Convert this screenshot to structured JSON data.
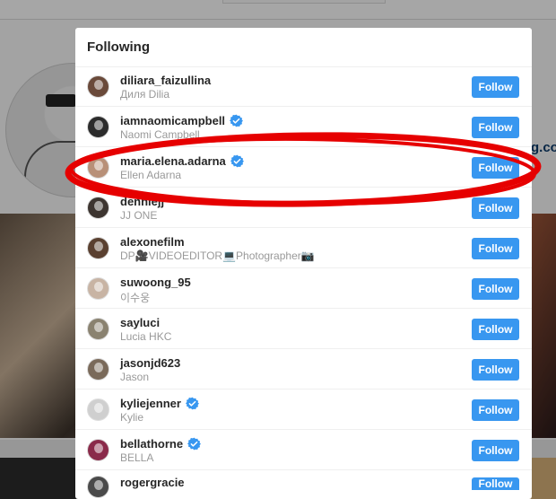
{
  "background": {
    "link_fragment": "g.co"
  },
  "modal": {
    "title": "Following",
    "follow_label": "Follow",
    "accent_color": "#3897f0",
    "highlight_color": "#e60000",
    "highlighted_user": "maria.elena.adarna",
    "users": [
      {
        "username": "diliara_faizullina",
        "full_name": "Диля Dilia",
        "verified": false,
        "avatar_color": "#6a4a3a"
      },
      {
        "username": "iamnaomicampbell",
        "full_name": "Naomi Campbell",
        "verified": true,
        "avatar_color": "#2c2c2c"
      },
      {
        "username": "maria.elena.adarna",
        "full_name": "Ellen Adarna",
        "verified": true,
        "avatar_color": "#b89078"
      },
      {
        "username": "denniejj",
        "full_name": "JJ ONE",
        "verified": false,
        "avatar_color": "#3d3530"
      },
      {
        "username": "alexonefilm",
        "full_name": "DP🎥VIDEOEDITOR💻Photographer📷",
        "verified": false,
        "avatar_color": "#5a4030"
      },
      {
        "username": "suwoong_95",
        "full_name": "이수웅",
        "verified": false,
        "avatar_color": "#c8b4a4"
      },
      {
        "username": "sayluci",
        "full_name": "Lucia HKC",
        "verified": false,
        "avatar_color": "#8a8270"
      },
      {
        "username": "jasonjd623",
        "full_name": "Jason",
        "verified": false,
        "avatar_color": "#7a6a5a"
      },
      {
        "username": "kyliejenner",
        "full_name": "Kylie",
        "verified": true,
        "avatar_color": "#cfcfcf"
      },
      {
        "username": "bellathorne",
        "full_name": "BELLA",
        "verified": true,
        "avatar_color": "#8a2a4a"
      },
      {
        "username": "rogergracie",
        "full_name": "",
        "verified": false,
        "avatar_color": "#4a4a4a"
      }
    ]
  }
}
